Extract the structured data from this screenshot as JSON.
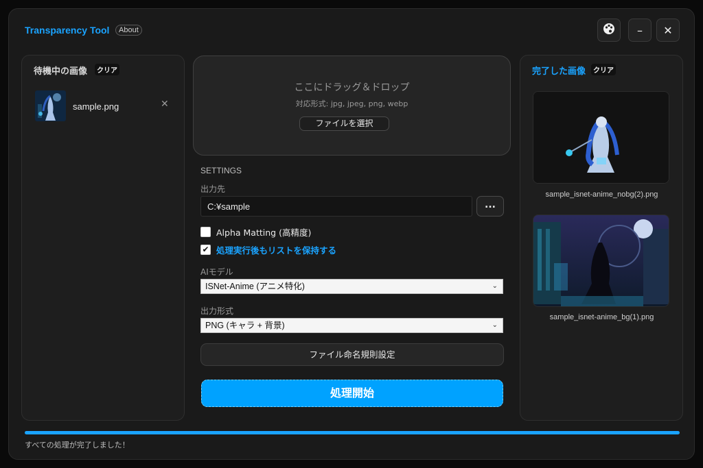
{
  "app": {
    "title": "Transparency Tool",
    "about_label": "About"
  },
  "window_controls": {
    "theme_icon": "palette-icon",
    "minimize_label": "–",
    "close_label": "✕"
  },
  "queue": {
    "title": "待機中の画像",
    "clear_label": "クリア",
    "items": [
      {
        "name": "sample.png",
        "remove_label": "✕"
      }
    ]
  },
  "dropzone": {
    "title": "ここにドラッグ＆ドロップ",
    "supported": "対応形式: jpg, jpeg, png, webp",
    "select_button": "ファイルを選択"
  },
  "settings": {
    "heading": "SETTINGS",
    "output_dir_label": "出力先",
    "output_dir_value": "C:¥sample",
    "browse_label": "...",
    "alpha_matting": {
      "label": "Alpha Matting (高精度)",
      "checked": false
    },
    "keep_list": {
      "label": "処理実行後もリストを保持する",
      "checked": true
    },
    "model_label": "AIモデル",
    "model_value": "ISNet-Anime (アニメ特化)",
    "format_label": "出力形式",
    "format_value": "PNG (キャラ + 背景)",
    "naming_button": "ファイル命名規則設定",
    "start_button": "処理開始"
  },
  "completed": {
    "title": "完了した画像",
    "clear_label": "クリア",
    "items": [
      {
        "name": "sample_isnet-anime_nobg(2).png"
      },
      {
        "name": "sample_isnet-anime_bg(1).png"
      }
    ]
  },
  "progress": {
    "value": 1.0
  },
  "status_text": "すべての処理が完了しました！",
  "colors": {
    "accent": "#1aa3ff",
    "start_button": "#00a2ff",
    "background": "#1a1a1a",
    "panel": "#1e1e1e"
  }
}
